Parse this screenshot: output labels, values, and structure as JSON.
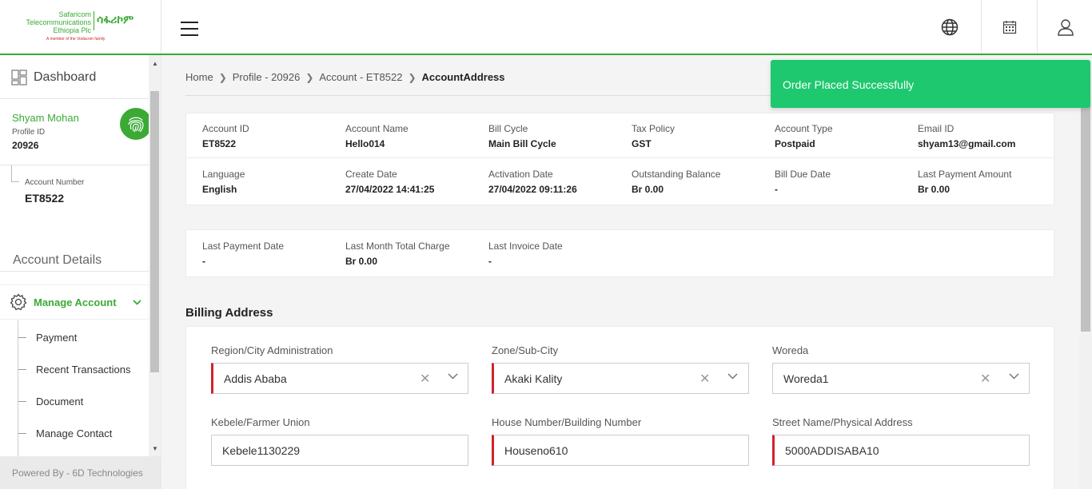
{
  "header": {
    "logo_lines": [
      "Safaricom",
      "Telecommunications",
      "Ethiopia Plc"
    ],
    "logo_amharic": "ሳፋሪኮም",
    "logo_tagline": "A member of the Vodacom family"
  },
  "sidebar": {
    "dashboard_label": "Dashboard",
    "customer_name": "Shyam Mohan",
    "profile_id_label": "Profile ID",
    "profile_id": "20926",
    "account_number_label": "Account Number",
    "account_number": "ET8522",
    "section_title": "Account Details",
    "manage_account_label": "Manage Account",
    "sub_items": [
      "Payment",
      "Recent Transactions",
      "Document",
      "Manage Contact"
    ],
    "footer": "Powered By - 6D Technologies"
  },
  "breadcrumb": [
    "Home",
    "Profile - 20926",
    "Account - ET8522",
    "AccountAddress"
  ],
  "account_summary": [
    {
      "label": "Account ID",
      "value": "ET8522"
    },
    {
      "label": "Account Name",
      "value": "Hello014"
    },
    {
      "label": "Bill Cycle",
      "value": "Main Bill Cycle"
    },
    {
      "label": "Tax Policy",
      "value": "GST"
    },
    {
      "label": "Account Type",
      "value": "Postpaid"
    },
    {
      "label": "Email ID",
      "value": "shyam13@gmail.com"
    },
    {
      "label": "Language",
      "value": "English"
    },
    {
      "label": "Create Date",
      "value": "27/04/2022 14:41:25"
    },
    {
      "label": "Activation Date",
      "value": "27/04/2022 09:11:26"
    },
    {
      "label": "Outstanding Balance",
      "value": "Br 0.00"
    },
    {
      "label": "Bill Due Date",
      "value": "-"
    },
    {
      "label": "Last Payment Amount",
      "value": "Br 0.00"
    }
  ],
  "payment_summary": [
    {
      "label": "Last Payment Date",
      "value": "-"
    },
    {
      "label": "Last Month Total Charge",
      "value": "Br 0.00"
    },
    {
      "label": "Last Invoice Date",
      "value": "-"
    }
  ],
  "billing_address": {
    "title": "Billing Address",
    "region_label": "Region/City Administration",
    "region_value": "Addis Ababa",
    "zone_label": "Zone/Sub-City",
    "zone_value": "Akaki Kality",
    "woreda_label": "Woreda",
    "woreda_value": "Woreda1",
    "kebele_label": "Kebele/Farmer Union",
    "kebele_value": "Kebele1130229",
    "house_label": "House Number/Building Number",
    "house_value": "Houseno610",
    "street_label": "Street Name/Physical Address",
    "street_value": "5000ADDISABA10"
  },
  "toast": {
    "message": "Order Placed Successfully"
  },
  "colors": {
    "brand_green": "#3aaa35",
    "toast_green": "#1ec86e",
    "required_red": "#d2232a"
  }
}
